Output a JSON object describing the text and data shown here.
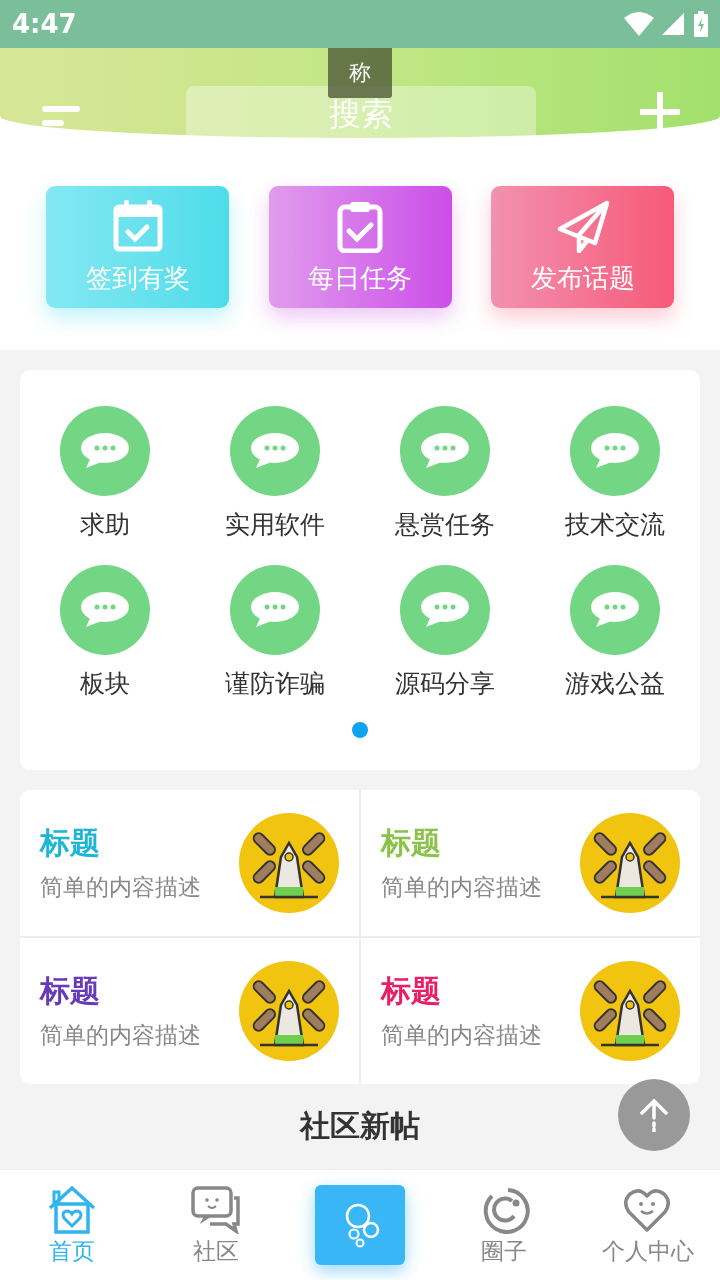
{
  "status_bar": {
    "time": "4:47"
  },
  "header": {
    "tooltip": "称",
    "search": {
      "placeholder": "搜索"
    }
  },
  "quick_actions": [
    {
      "label": "签到有奖",
      "kind": "calendar"
    },
    {
      "label": "每日任务",
      "kind": "clipboard"
    },
    {
      "label": "发布话题",
      "kind": "send"
    }
  ],
  "categories": {
    "items": [
      {
        "label": "求助"
      },
      {
        "label": "实用软件"
      },
      {
        "label": "悬赏任务"
      },
      {
        "label": "技术交流"
      },
      {
        "label": "板块"
      },
      {
        "label": "谨防诈骗"
      },
      {
        "label": "源码分享"
      },
      {
        "label": "游戏公益"
      }
    ],
    "pages": [
      {
        "selected": true
      }
    ]
  },
  "features": [
    {
      "title": "标题",
      "description": "简单的内容描述",
      "color": "#1fb5d6"
    },
    {
      "title": "标题",
      "description": "简单的内容描述",
      "color": "#8bc34a"
    },
    {
      "title": "标题",
      "description": "简单的内容描述",
      "color": "#673ab7"
    },
    {
      "title": "标题",
      "description": "简单的内容描述",
      "color": "#e91e63"
    }
  ],
  "section_title": "社区新帖",
  "bottom_nav": [
    {
      "label": "首页",
      "kind": "home",
      "selected": true
    },
    {
      "label": "社区",
      "kind": "chat",
      "selected": false
    },
    {
      "kind": "bubbles",
      "selected": false
    },
    {
      "label": "圈子",
      "kind": "ring",
      "selected": false
    },
    {
      "label": "个人中心",
      "kind": "heart",
      "selected": false
    }
  ]
}
